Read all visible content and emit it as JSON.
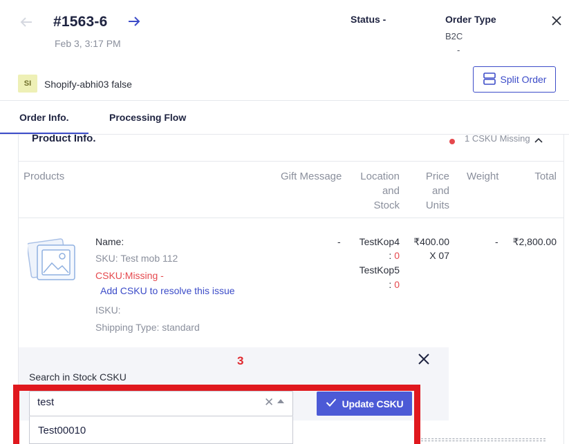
{
  "header": {
    "order_id": "#1563-6",
    "date": "Feb 3, 3:17 PM",
    "status_label": "Status -",
    "order_type_label": "Order Type",
    "order_type_value": "B2C",
    "order_type_dash": "-"
  },
  "store": {
    "badge": "SI",
    "name": "Shopify-abhi03 false"
  },
  "split_button": {
    "label": "Split Order"
  },
  "tabs": [
    {
      "label": "Order Info.",
      "active": true
    },
    {
      "label": "Processing Flow",
      "active": false
    }
  ],
  "product_info": {
    "title": "Product Info.",
    "missing_label": "1 CSKU Missing",
    "columns": [
      "Products",
      "Gift Message",
      "Location and Stock",
      "Price and Units",
      "Weight",
      "Total"
    ],
    "column_lines": {
      "loc": [
        "Location",
        "and",
        "Stock"
      ],
      "price": [
        "Price",
        "and",
        "Units"
      ]
    },
    "item": {
      "name": "Name:",
      "sku": "SKU: Test mob 112",
      "csku": "CSKU:Missing -",
      "add_csku": "Add CSKU to resolve this issue",
      "isku": "ISKU:",
      "shipping": "Shipping Type: standard",
      "gift": "-",
      "locations": [
        {
          "name": "TestKop4",
          "stock": "0"
        },
        {
          "name": "TestKop5",
          "stock": "0"
        }
      ],
      "price": "₹400.00",
      "units": "X 07",
      "weight": "-",
      "total": "₹2,800.00"
    }
  },
  "search_panel": {
    "number": "3",
    "label": "Search in Stock CSKU",
    "input_value": "test",
    "update_button": "Update CSKU",
    "options": [
      "Test00010"
    ]
  },
  "colors": {
    "accent": "#3b4bc8",
    "button": "#4c5ad6",
    "highlight": "#e0181e",
    "error": "#e5484d"
  }
}
